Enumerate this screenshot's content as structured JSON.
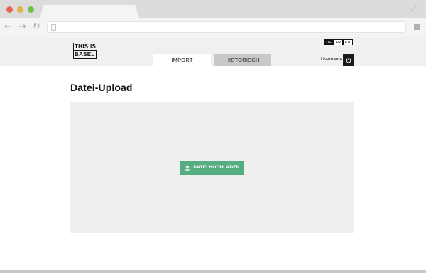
{
  "browser": {
    "back_icon": "←",
    "forward_icon": "→",
    "reload_icon": "↻",
    "expand_icon": "⤢"
  },
  "header": {
    "logo": {
      "line1_word1": "THIS",
      "line1_word2": "IS",
      "line2": "BASEL"
    },
    "tabs": [
      {
        "label": "IMPORT",
        "active": true
      },
      {
        "label": "HISTORISCH",
        "active": false
      }
    ],
    "languages": [
      {
        "label": "DE",
        "active": true
      },
      {
        "label": "FR",
        "active": false
      },
      {
        "label": "EN",
        "active": false
      }
    ],
    "username": "Username"
  },
  "main": {
    "title": "Datei-Upload",
    "upload_button_label": "DATEI HOCHLADEN"
  },
  "colors": {
    "accent": "#57ad82",
    "dark": "#1a1a1a",
    "dropzone": "#efefef"
  }
}
